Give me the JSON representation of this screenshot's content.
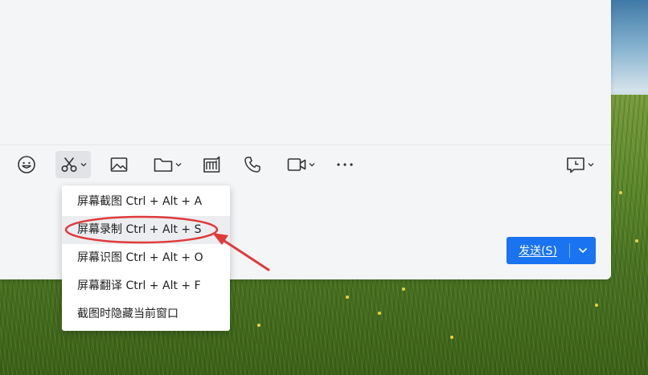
{
  "toolbar": {
    "buttons": [
      {
        "name": "emoji-button",
        "icon": "smiley-icon"
      },
      {
        "name": "screenshot-button",
        "icon": "scissors-icon",
        "dropdown": true,
        "active": true
      },
      {
        "name": "image-button",
        "icon": "image-icon"
      },
      {
        "name": "file-button",
        "icon": "folder-icon",
        "dropdown": true
      },
      {
        "name": "doc-button",
        "icon": "document-icon"
      },
      {
        "name": "voice-call-button",
        "icon": "phone-icon"
      },
      {
        "name": "video-call-button",
        "icon": "video-camera-icon",
        "dropdown": true
      },
      {
        "name": "more-button",
        "icon": "more-icon"
      },
      {
        "name": "chat-history-button",
        "icon": "message-clock-icon",
        "dropdown": true
      }
    ]
  },
  "send": {
    "label": "发送(S)",
    "color": "#1a73f0"
  },
  "screenshot_menu": {
    "items": [
      {
        "label": "屏幕截图 Ctrl + Alt + A"
      },
      {
        "label": "屏幕录制 Ctrl + Alt + S",
        "highlighted": true
      },
      {
        "label": "屏幕识图 Ctrl + Alt + O"
      },
      {
        "label": "屏幕翻译 Ctrl + Alt + F"
      },
      {
        "label": "截图时隐藏当前窗口"
      }
    ]
  },
  "annotation": {
    "color": "#e03a3a",
    "shape": "ellipse-with-arrow"
  }
}
